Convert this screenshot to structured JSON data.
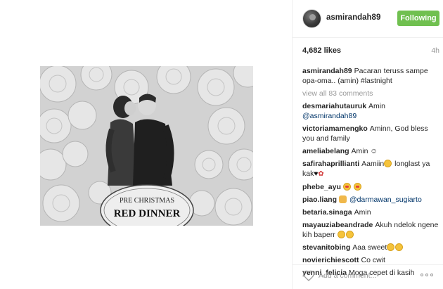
{
  "header": {
    "username": "asmirandah89",
    "follow_label": "Following"
  },
  "post": {
    "likes": "4,682 likes",
    "time": "4h",
    "sign_line1": "PRE CHRISTMAS",
    "sign_line2": "RED DINNER"
  },
  "caption": {
    "user": "asmirandah89",
    "text": "Pacaran teruss sampe opa-oma.. (amin) #lastnight"
  },
  "view_all": "view all 83 comments",
  "comments": [
    {
      "user": "desmariahutauruk",
      "text": "Amin ",
      "tag": "@asmirandah89"
    },
    {
      "user": "victoriamamengko",
      "text": "Aminn, God bless you and family"
    },
    {
      "user": "ameliabelang",
      "text": "Amin ☺"
    },
    {
      "user": "safirahaprillianti",
      "text": "Aamiin",
      "text2": " longlast ya kak"
    },
    {
      "user": "phebe_ayu",
      "text": ""
    },
    {
      "user": "piao.liang",
      "tag": "@darmawan_sugiarto"
    },
    {
      "user": "betaria.sinaga",
      "text": "Amin"
    },
    {
      "user": "mayauziabeandrade",
      "text": "Akuh ndelok ngene kih baperr"
    },
    {
      "user": "stevanitobing",
      "text": "Aaa sweet"
    },
    {
      "user": "novierichiescott",
      "text": "Co cwit"
    },
    {
      "user": "yenni_felicia",
      "text": "Moga cepet di kasih"
    }
  ],
  "footer": {
    "placeholder": "Add a comment..."
  },
  "icons": {
    "like": "heart-outline-icon",
    "more": "more-options-icon"
  },
  "colors": {
    "follow_button": "#70c050",
    "link": "#003569",
    "muted": "#999999"
  }
}
